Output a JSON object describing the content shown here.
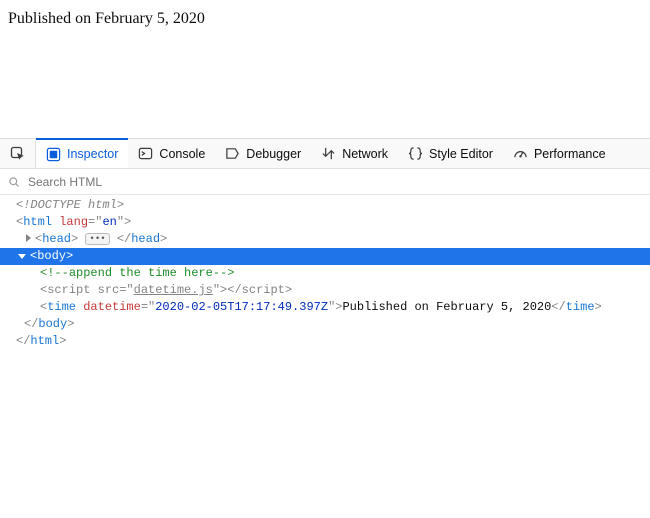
{
  "page": {
    "published_text": "Published on February 5, 2020"
  },
  "toolbar": {
    "tabs": {
      "inspector": "Inspector",
      "console": "Console",
      "debugger": "Debugger",
      "network": "Network",
      "style_editor": "Style Editor",
      "performance": "Performance"
    }
  },
  "search": {
    "placeholder": "Search HTML"
  },
  "markup": {
    "doctype": "<!DOCTYPE html>",
    "html_open_tag": "html",
    "html_lang_attr": "lang",
    "html_lang_val": "en",
    "head_tag": "head",
    "body_tag": "body",
    "comment_text": "append the time here",
    "script_tag": "script",
    "script_src_attr": "src",
    "script_src_val": "datetime.js",
    "time_tag": "time",
    "time_attr": "datetime",
    "time_attr_val": "2020-02-05T17:17:49.397Z",
    "time_text": "Published on February 5, 2020",
    "html_close": "html"
  }
}
